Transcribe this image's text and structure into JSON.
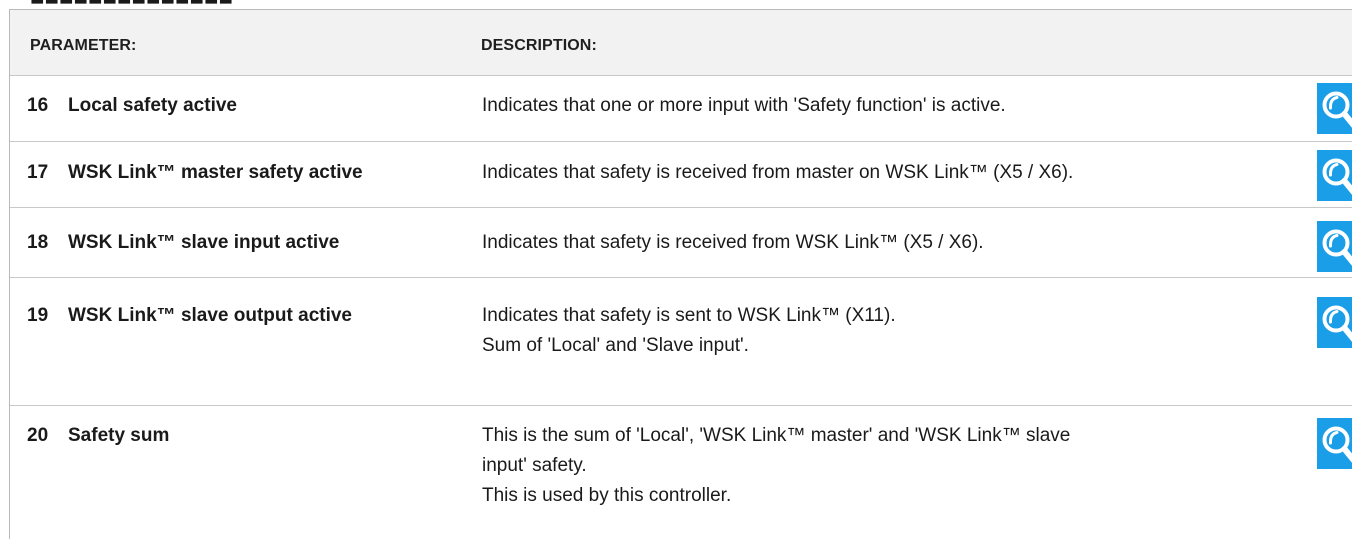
{
  "header": {
    "parameter_label": "PARAMETER:",
    "description_label": "DESCRIPTION:"
  },
  "rows": [
    {
      "number": "16",
      "name": "Local safety active",
      "description": [
        "Indicates that one or more input with 'Safety function' is active."
      ],
      "button_icon": "magnifier-icon"
    },
    {
      "number": "17",
      "name": "WSK Link™ master safety active",
      "description": [
        "Indicates that safety is received from master on WSK Link™ (X5 / X6)."
      ],
      "button_icon": "magnifier-icon"
    },
    {
      "number": "18",
      "name": "WSK Link™ slave input active",
      "description": [
        "Indicates that safety is received from WSK Link™ (X5 / X6)."
      ],
      "button_icon": "magnifier-icon"
    },
    {
      "number": "19",
      "name": "WSK Link™ slave output active",
      "description": [
        "Indicates that safety is sent to WSK Link™ (X11).",
        "Sum of 'Local' and 'Slave input'."
      ],
      "button_icon": "magnifier-icon"
    },
    {
      "number": "20",
      "name": "Safety sum",
      "description": [
        "This is the sum of 'Local', 'WSK Link™ master' and 'WSK Link™ slave",
        "input' safety.",
        "This is used by this controller."
      ],
      "button_icon": "magnifier-icon"
    }
  ],
  "colors": {
    "button": "#1b9ee8",
    "header_background": "#f2f2f2",
    "grid_line": "#c8c8c8"
  }
}
